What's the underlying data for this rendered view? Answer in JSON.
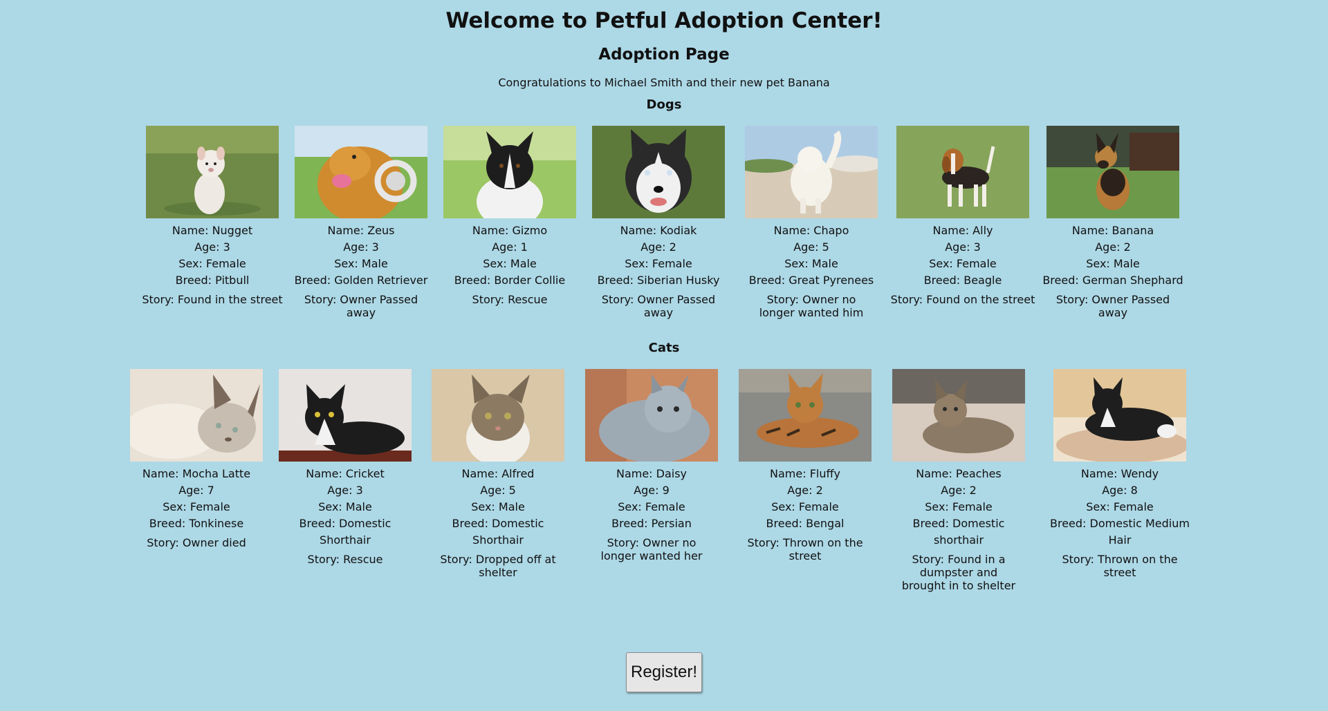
{
  "page": {
    "title": "Welcome to Petful Adoption Center!",
    "subtitle": "Adoption Page",
    "congrats": "Congratulations to Michael Smith and their new pet Banana"
  },
  "dogs": {
    "heading": "Dogs",
    "items": [
      {
        "name": "Name: Nugget",
        "age": "Age: 3",
        "sex": "Sex: Female",
        "breed": "Breed: Pitbull",
        "story": "Story: Found in the street",
        "photo": "white-pitbull-photo"
      },
      {
        "name": "Name: Zeus",
        "age": "Age: 3",
        "sex": "Sex: Male",
        "breed": "Breed: Golden Retriever",
        "story": "Story: Owner Passed away",
        "photo": "golden-retriever-headphones-photo"
      },
      {
        "name": "Name: Gizmo",
        "age": "Age: 1",
        "sex": "Sex: Male",
        "breed": "Breed: Border Collie",
        "story": "Story: Rescue",
        "photo": "border-collie-photo"
      },
      {
        "name": "Name: Kodiak",
        "age": "Age: 2",
        "sex": "Sex: Female",
        "breed": "Breed: Siberian Husky",
        "story": "Story: Owner Passed away",
        "photo": "husky-photo"
      },
      {
        "name": "Name: Chapo",
        "age": "Age: 5",
        "sex": "Sex: Male",
        "breed": "Breed: Great Pyrenees",
        "story": "Story: Owner no longer wanted him",
        "photo": "great-pyrenees-photo"
      },
      {
        "name": "Name: Ally",
        "age": "Age: 3",
        "sex": "Sex: Female",
        "breed": "Breed: Beagle",
        "story": "Story: Found on the street",
        "photo": "beagle-photo"
      },
      {
        "name": "Name: Banana",
        "age": "Age: 2",
        "sex": "Sex: Male",
        "breed": "Breed: German Shephard",
        "story": "Story: Owner Passed away",
        "photo": "german-shepherd-photo"
      }
    ]
  },
  "cats": {
    "heading": "Cats",
    "items": [
      {
        "name": "Name: Mocha Latte",
        "age": "Age: 7",
        "sex": "Sex: Female",
        "breed": "Breed: Tonkinese",
        "story": "Story: Owner died",
        "photo": "tonkinese-cat-photo"
      },
      {
        "name": "Name: Cricket",
        "age": "Age: 3",
        "sex": "Sex: Male",
        "breed": "Breed: Domestic Shorthair",
        "story": "Story: Rescue",
        "photo": "tuxedo-cat-photo"
      },
      {
        "name": "Name: Alfred",
        "age": "Age: 5",
        "sex": "Sex: Male",
        "breed": "Breed: Domestic Shorthair",
        "story": "Story: Dropped off at shelter",
        "photo": "tabby-kitten-photo"
      },
      {
        "name": "Name: Daisy",
        "age": "Age: 9",
        "sex": "Sex: Female",
        "breed": "Breed: Persian",
        "story": "Story: Owner no longer wanted her",
        "photo": "persian-cat-photo"
      },
      {
        "name": "Name: Fluffy",
        "age": "Age: 2",
        "sex": "Sex: Female",
        "breed": "Breed: Bengal",
        "story": "Story: Thrown on the street",
        "photo": "bengal-cat-photo"
      },
      {
        "name": "Name: Peaches",
        "age": "Age: 2",
        "sex": "Sex: Female",
        "breed": "Breed: Domestic shorthair",
        "story": "Story: Found in a dumpster and brought in to shelter",
        "photo": "tabby-cat-photo"
      },
      {
        "name": "Name: Wendy",
        "age": "Age: 8",
        "sex": "Sex: Female",
        "breed": "Breed: Domestic Medium Hair",
        "story": "Story: Thrown on the street",
        "photo": "black-white-cat-photo"
      }
    ]
  },
  "register": {
    "label": "Register!"
  },
  "colors": {
    "background": "#add8e6",
    "button": "#e6e6e6"
  }
}
